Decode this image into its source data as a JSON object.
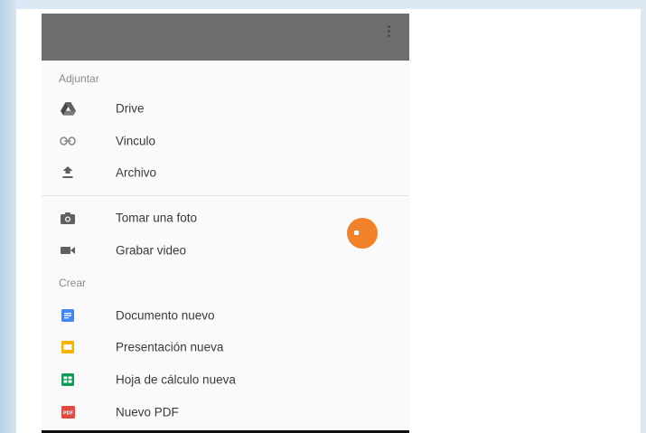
{
  "sections": {
    "attach_header": "Adjuntar",
    "create_header": "Crear"
  },
  "attach_items": [
    {
      "label": "Drive",
      "icon": "drive-icon"
    },
    {
      "label": "Vinculo",
      "icon": "link-icon"
    },
    {
      "label": "Archivo",
      "icon": "upload-icon"
    },
    {
      "label": "Tomar una foto",
      "icon": "camera-icon"
    },
    {
      "label": "Grabar video",
      "icon": "video-icon"
    }
  ],
  "create_items": [
    {
      "label": "Documento nuevo",
      "icon": "docs-icon",
      "color": "#4285f4"
    },
    {
      "label": "Presentación nueva",
      "icon": "slides-icon",
      "color": "#f4b400"
    },
    {
      "label": "Hoja de cálculo nueva",
      "icon": "sheets-icon",
      "color": "#0f9d58"
    },
    {
      "label": "Nuevo PDF",
      "icon": "pdf-icon",
      "color": "#e04a3f"
    }
  ],
  "pdf_icon_text": "PDF",
  "colors": {
    "appbar": "#6e6e6e",
    "fab": "#f2822a",
    "icon_gray": "#616161"
  }
}
